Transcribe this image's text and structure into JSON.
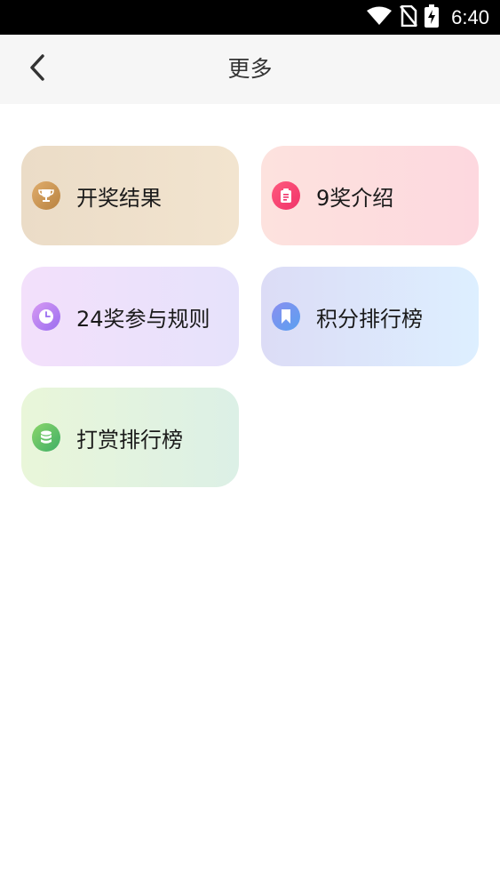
{
  "status_bar": {
    "time": "6:40",
    "icons": [
      "wifi-icon",
      "no-sim-icon",
      "battery-charging-icon"
    ]
  },
  "nav": {
    "back_icon": "chevron-left-icon",
    "title": "更多"
  },
  "menu": {
    "items": [
      {
        "label": "开奖结果",
        "icon": "trophy-icon"
      },
      {
        "label": "9奖介绍",
        "icon": "clipboard-icon"
      },
      {
        "label": "24奖参与规则",
        "icon": "clock-icon"
      },
      {
        "label": "积分排行榜",
        "icon": "bookmark-icon"
      },
      {
        "label": "打赏排行榜",
        "icon": "database-icon"
      }
    ]
  }
}
